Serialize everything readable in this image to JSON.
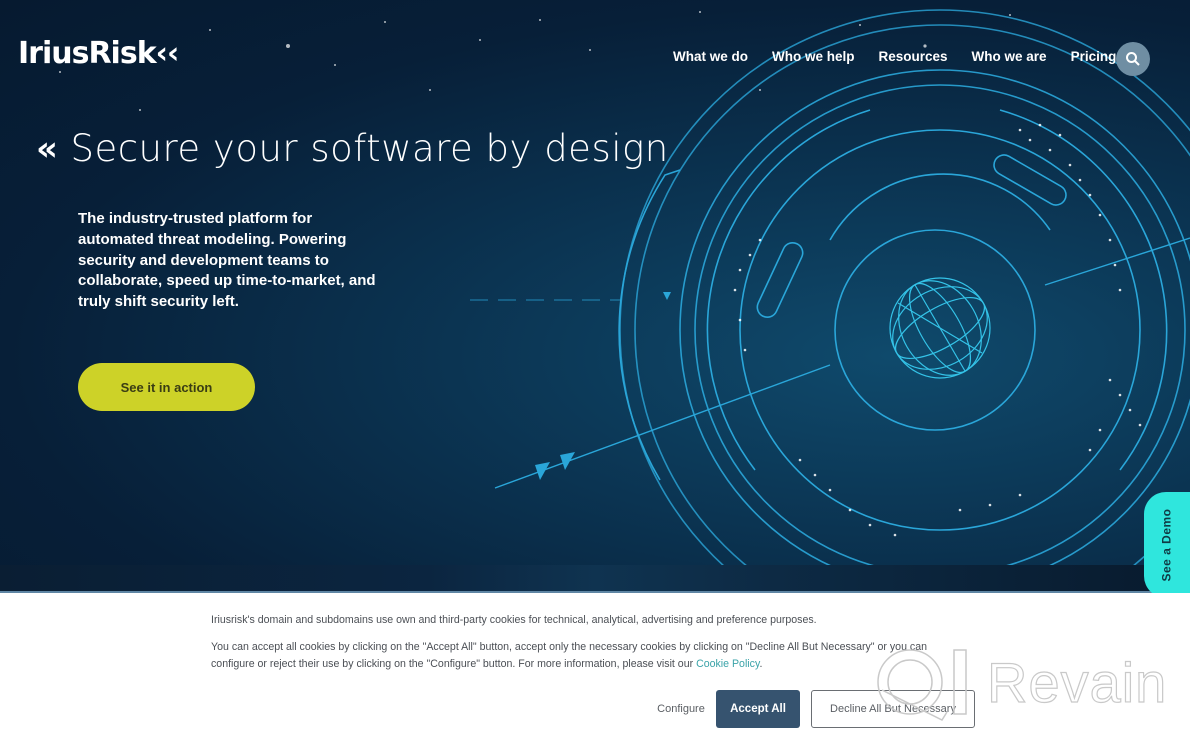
{
  "brand": {
    "logo_text": "IriusRisk"
  },
  "nav": {
    "items": [
      {
        "label": "What we do"
      },
      {
        "label": "Who we help"
      },
      {
        "label": "Resources"
      },
      {
        "label": "Who we are"
      },
      {
        "label": "Pricing"
      }
    ],
    "search_icon": "search-icon"
  },
  "hero": {
    "chevron_icon": "«",
    "headline": "Secure your software by design",
    "lede": "The industry-trusted platform for automated threat modeling. Powering security and development teams to collaborate, speed up time-to-market, and truly shift security left.",
    "cta_label": "See it in action",
    "demo_tab_label": "See a Demo"
  },
  "cookie_banner": {
    "line1": "Iriusrisk's domain and subdomains use own and third-party cookies for technical, analytical, advertising and preference purposes.",
    "line2": "You can accept all cookies by clicking on the \"Accept All\" button, accept only the necessary cookies by clicking on \"Decline All But Necessary\" or you can configure or reject their use by clicking on the \"Configure\" button. For more information, please visit our ",
    "policy_link": "Cookie Policy",
    "line2_end": ".",
    "configure_label": "Configure",
    "accept_label": "Accept All",
    "decline_label": "Decline All But Necessary"
  },
  "watermark": {
    "text": "Revain"
  },
  "colors": {
    "hero_bg": "#071f38",
    "cta": "#cdd228",
    "demo_tab": "#2fe6dd",
    "accept_button": "#36536f",
    "link": "#3aa3a8",
    "art_line": "#2aa6d9"
  }
}
